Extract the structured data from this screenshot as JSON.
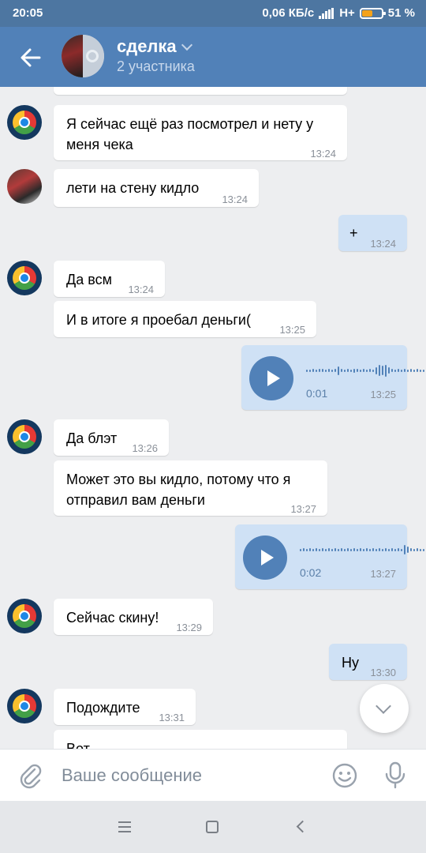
{
  "status_bar": {
    "time": "20:05",
    "network_speed": "0,06 КБ/с",
    "network_type": "H+",
    "battery": "51 %"
  },
  "header": {
    "title": "сделка",
    "subtitle": "2 участника"
  },
  "messages": [
    {
      "text": "Я сейчас ещё раз посмотрел и нету у меня чека",
      "time": "13:24"
    },
    {
      "text": "лети на стену кидло",
      "time": "13:24"
    },
    {
      "text": "+",
      "time": "13:24"
    },
    {
      "text": "Да всм",
      "time": "13:24"
    },
    {
      "text": "И в итоге я проебал деньги(",
      "time": "13:25"
    },
    {
      "duration": "0:01",
      "time": "13:25"
    },
    {
      "text": "Да блэт",
      "time": "13:26"
    },
    {
      "text": "Может это вы кидло, потому что я отправил вам деньги",
      "time": "13:27"
    },
    {
      "duration": "0:02",
      "time": "13:27"
    },
    {
      "text": "Сейчас скину!",
      "time": "13:29"
    },
    {
      "text": "Ну",
      "time": "13:30"
    },
    {
      "text": "Подождите",
      "time": "13:31"
    },
    {
      "text": "Вот"
    }
  ],
  "composer": {
    "placeholder": "Ваше сообщение"
  },
  "colors": {
    "header": "#5181b8",
    "status_bar": "#4d76a1",
    "outgoing_bubble": "#cfe1f5",
    "incoming_bubble": "#ffffff",
    "background": "#edeef0"
  }
}
